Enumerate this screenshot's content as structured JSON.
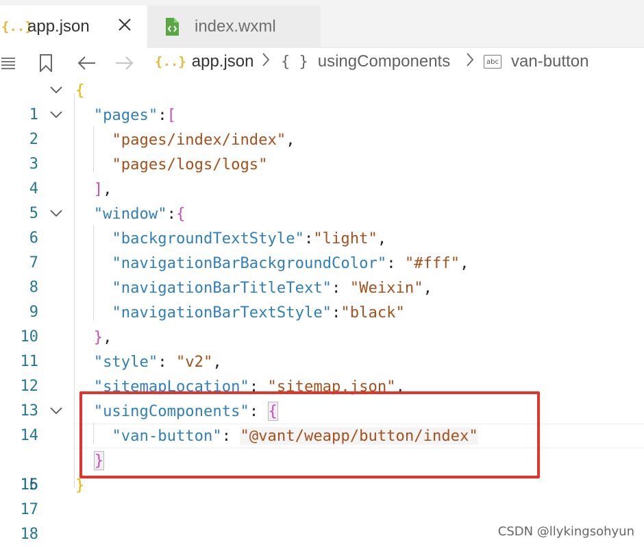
{
  "tabs": [
    {
      "label": "app.json",
      "icon": "json-file-icon",
      "active": true
    },
    {
      "label": "index.wxml",
      "icon": "wxml-file-icon",
      "active": false
    }
  ],
  "json_icon_glyph": "{..}",
  "breadcrumb": {
    "items": [
      {
        "icon_glyph": "{..}",
        "label": "app.json"
      },
      {
        "icon_glyph": "{ }",
        "label": "usingComponents"
      },
      {
        "icon_glyph": "abc",
        "label": "van-button"
      }
    ]
  },
  "editor": {
    "line_numbers": [
      "1",
      "2",
      "3",
      "4",
      "5",
      "6",
      "7",
      "8",
      "9",
      "10",
      "11",
      "12",
      "13",
      "14",
      "15",
      "16",
      "17",
      "18"
    ],
    "current_line": "15",
    "colors": {
      "key": "#2f7fbd",
      "string": "#a8501c",
      "bracket_level1": "#e8b300",
      "bracket_level2": "#c64dbb",
      "bracket_level3": "#2a7dd6",
      "highlight_box": "#e6332a"
    },
    "lines": {
      "l2_key": "\"pages\"",
      "l3_val": "\"pages/index/index\"",
      "l4_val": "\"pages/logs/logs\"",
      "l6_key": "\"window\"",
      "l7_key": "\"backgroundTextStyle\"",
      "l7_val": "\"light\"",
      "l8_key": "\"navigationBarBackgroundColor\"",
      "l8_val": "\"#fff\"",
      "l9_key": "\"navigationBarTitleText\"",
      "l9_val": "\"Weixin\"",
      "l10_key": "\"navigationBarTextStyle\"",
      "l10_val": "\"black\"",
      "l12_key": "\"style\"",
      "l12_val": "\"v2\"",
      "l13_key": "\"sitemapLocation\"",
      "l13_val": "\"sitemap.json\"",
      "l14_key": "\"usingComponents\"",
      "l15_key": "\"van-button\"",
      "l15_val": "\"@vant/weapp/button/index\""
    }
  },
  "watermark": "CSDN @llykingsohyun"
}
